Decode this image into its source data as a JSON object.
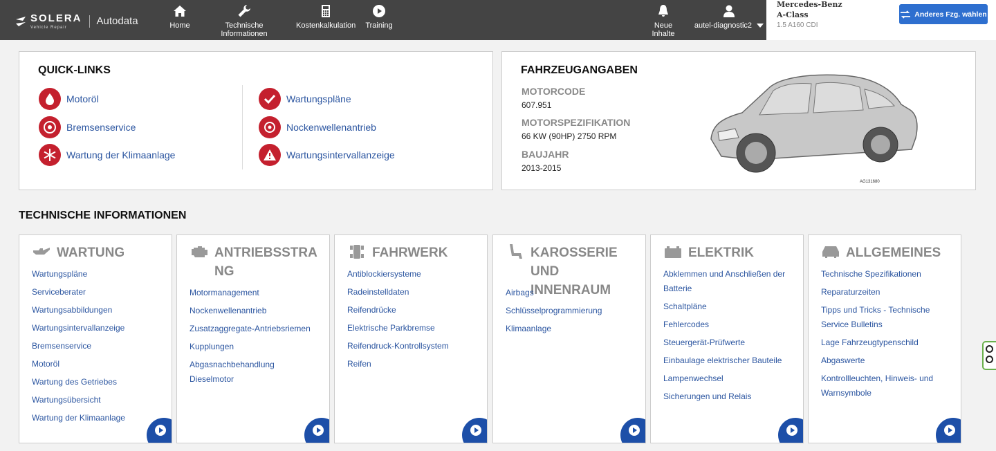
{
  "header": {
    "logo_brand": "SOLERA",
    "logo_sub": "Vehicle Repair",
    "logo_product": "Autodata",
    "nav": [
      {
        "label": "Home",
        "icon": "home-icon"
      },
      {
        "label": "Technische Informationen",
        "icon": "wrench-icon"
      },
      {
        "label": "Kostenkalkulation",
        "icon": "calculator-icon"
      },
      {
        "label": "Training",
        "icon": "play-icon"
      }
    ],
    "news_label": "Neue Inhalte",
    "user_label": "autel-diagnostic2"
  },
  "vehicle": {
    "make": "Mercedes-Benz",
    "model": "A-Class",
    "engine": "1.5 A160 CDI",
    "change_button": "Anderes Fzg. wählen"
  },
  "quick_links": {
    "title": "QUICK-LINKS",
    "left": [
      {
        "label": "Motoröl",
        "icon": "oil-drop-icon"
      },
      {
        "label": "Bremsenservice",
        "icon": "brake-disc-icon"
      },
      {
        "label": "Wartung der Klimaanlage",
        "icon": "snowflake-icon"
      }
    ],
    "right": [
      {
        "label": "Wartungspläne",
        "icon": "checkmark-icon"
      },
      {
        "label": "Nockenwellenantrieb",
        "icon": "timing-belt-icon"
      },
      {
        "label": "Wartungsintervallanzeige",
        "icon": "warning-icon"
      }
    ]
  },
  "vehicle_info": {
    "title": "FAHRZEUGANGABEN",
    "engine_code_label": "MOTORCODE",
    "engine_code": "607.951",
    "engine_spec_label": "MOTORSPEZIFIKATION",
    "engine_spec": "66 KW (90HP) 2750 RPM",
    "year_label": "BAUJAHR",
    "year": "2013-2015",
    "image_caption": "AG131680"
  },
  "technical_info": {
    "title": "TECHNISCHE INFORMATIONEN",
    "cards": [
      {
        "title": "WARTUNG",
        "icon": "oil-can-icon",
        "links": [
          "Wartungspläne",
          "Serviceberater",
          "Wartungsabbildungen",
          "Wartungsintervallanzeige",
          "Bremsenservice",
          "Motoröl",
          "Wartung des Getriebes",
          "Wartungsübersicht",
          "Wartung der Klimaanlage"
        ]
      },
      {
        "title": "ANTRIEBSSTRANG",
        "icon": "engine-icon",
        "links": [
          "Motormanagement",
          "Nockenwellenantrieb",
          "Zusatzaggregate-Antriebsriemen",
          "Kupplungen",
          "Abgasnachbehandlung Dieselmotor"
        ]
      },
      {
        "title": "FAHRWERK",
        "icon": "chassis-icon",
        "links": [
          "Antiblockiersysteme",
          "Radeinstelldaten",
          "Reifendrücke",
          "Elektrische Parkbremse",
          "Reifendruck-Kontrollsystem",
          "Reifen"
        ]
      },
      {
        "title": "KAROSSERIE UND INNENRAUM",
        "icon": "seat-icon",
        "links": [
          "Airbags",
          "Schlüsselprogrammierung",
          "Klimaanlage"
        ]
      },
      {
        "title": "ELEKTRIK",
        "icon": "battery-icon",
        "links": [
          "Abklemmen und Anschließen der Batterie",
          "Schaltpläne",
          "Fehlercodes",
          "Steuergerät-Prüfwerte",
          "Einbaulage elektrischer Bauteile",
          "Lampenwechsel",
          "Sicherungen und Relais"
        ]
      },
      {
        "title": "ALLGEMEINES",
        "icon": "car-icon",
        "links": [
          "Technische Spezifikationen",
          "Reparaturzeiten",
          "Tipps und Tricks - Technische Service Bulletins",
          "Lage Fahrzeugtypenschild",
          "Abgaswerte",
          "Kontrollleuchten, Hinweis- und Warnsymbole"
        ]
      }
    ]
  },
  "colors": {
    "accent": "#2e6fcf",
    "quicklink_red": "#c4202e",
    "link_blue": "#2b55a0",
    "topbar": "#444444"
  }
}
